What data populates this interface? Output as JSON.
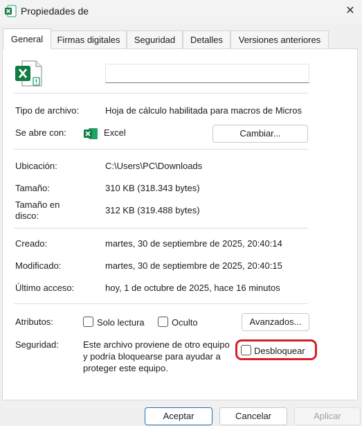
{
  "window": {
    "title": "Propiedades de",
    "close_glyph": "✕"
  },
  "tabs": [
    {
      "label": "General"
    },
    {
      "label": "Firmas digitales"
    },
    {
      "label": "Seguridad"
    },
    {
      "label": "Detalles"
    },
    {
      "label": "Versiones anteriores"
    }
  ],
  "general": {
    "file_name": "",
    "icon": "excel-macro-file-icon",
    "type_label": "Tipo de archivo:",
    "type_value": "Hoja de cálculo habilitada para macros de Micros",
    "opens_with_label": "Se abre con:",
    "opens_with_app": "Excel",
    "change_button": "Cambiar...",
    "location_label": "Ubicación:",
    "location_value": "C:\\Users\\PC\\Downloads",
    "size_label": "Tamaño:",
    "size_value": "310 KB (318.343 bytes)",
    "size_on_disk_label_line1": "Tamaño en",
    "size_on_disk_label_line2": "disco:",
    "size_on_disk_value": "312 KB (319.488 bytes)",
    "created_label": "Creado:",
    "created_value": "martes, 30 de septiembre de 2025, 20:40:14",
    "modified_label": "Modificado:",
    "modified_value": "martes, 30 de septiembre de 2025, 20:40:15",
    "accessed_label": "Último acceso:",
    "accessed_value": "hoy, 1 de octubre de 2025, hace 16 minutos",
    "attributes_label": "Atributos:",
    "readonly_label": "Solo lectura",
    "hidden_label": "Oculto",
    "advanced_button": "Avanzados...",
    "security_label": "Seguridad:",
    "security_line1": "Este archivo proviene de otro equipo",
    "security_line2": "y podría bloquearse para ayudar a",
    "security_line3": "proteger este equipo.",
    "unblock_label": "Desbloquear"
  },
  "footer": {
    "accept": "Aceptar",
    "cancel": "Cancelar",
    "apply": "Aplicar"
  },
  "colors": {
    "excel_green": "#107c41",
    "highlight_red": "#d61f26",
    "accent_blue": "#1f6fb5"
  }
}
